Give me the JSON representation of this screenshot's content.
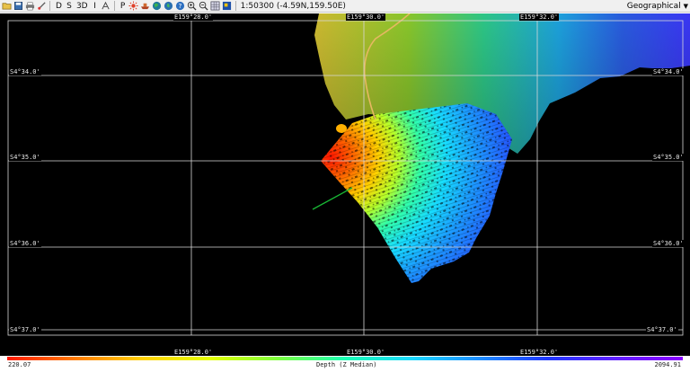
{
  "toolbar": {
    "buttons": [
      {
        "name": "open-icon",
        "type": "icon"
      },
      {
        "name": "save-icon",
        "type": "icon"
      },
      {
        "name": "print-icon",
        "type": "icon"
      },
      {
        "name": "measure-icon",
        "type": "icon"
      },
      {
        "name": "view-2d-button",
        "label": "D"
      },
      {
        "name": "view-s-button",
        "label": "S"
      },
      {
        "name": "view-3d-button",
        "label": "3D"
      },
      {
        "name": "info-button",
        "label": "I"
      },
      {
        "name": "fx-icon",
        "type": "icon"
      },
      {
        "name": "profile-button",
        "label": "P"
      }
    ],
    "text_buttons": {
      "d": "D",
      "s": "S",
      "three_d": "3D",
      "i": "I",
      "p": "P"
    },
    "scale_readout": "1:50300 (-4.59N,159.50E)",
    "projection": "Geographical"
  },
  "map": {
    "background_color": "#000000",
    "grid_color": "#d8d8d8",
    "longitude_labels_top": [
      "E159°28.0'",
      "E159°30.0'",
      "E159°32.0'"
    ],
    "longitude_labels_bottom": [
      "E159°28.0'",
      "E159°30.0'",
      "E159°32.0'"
    ],
    "latitude_labels_left": [
      "S4°34.0'",
      "S4°35.0'",
      "S4°36.0'",
      "S4°37.0'"
    ],
    "latitude_labels_right": [
      "S4°34.0'",
      "S4°35.0'",
      "S4°36.0'",
      "S4°37.0'"
    ]
  },
  "legend": {
    "min_label": "220.07",
    "title": "Depth (Z Median)",
    "max_label": "2094.91",
    "colors": [
      "#ff1a00",
      "#ffd000",
      "#7dff3c",
      "#19d8ff",
      "#2038ff",
      "#8a00ff"
    ]
  }
}
